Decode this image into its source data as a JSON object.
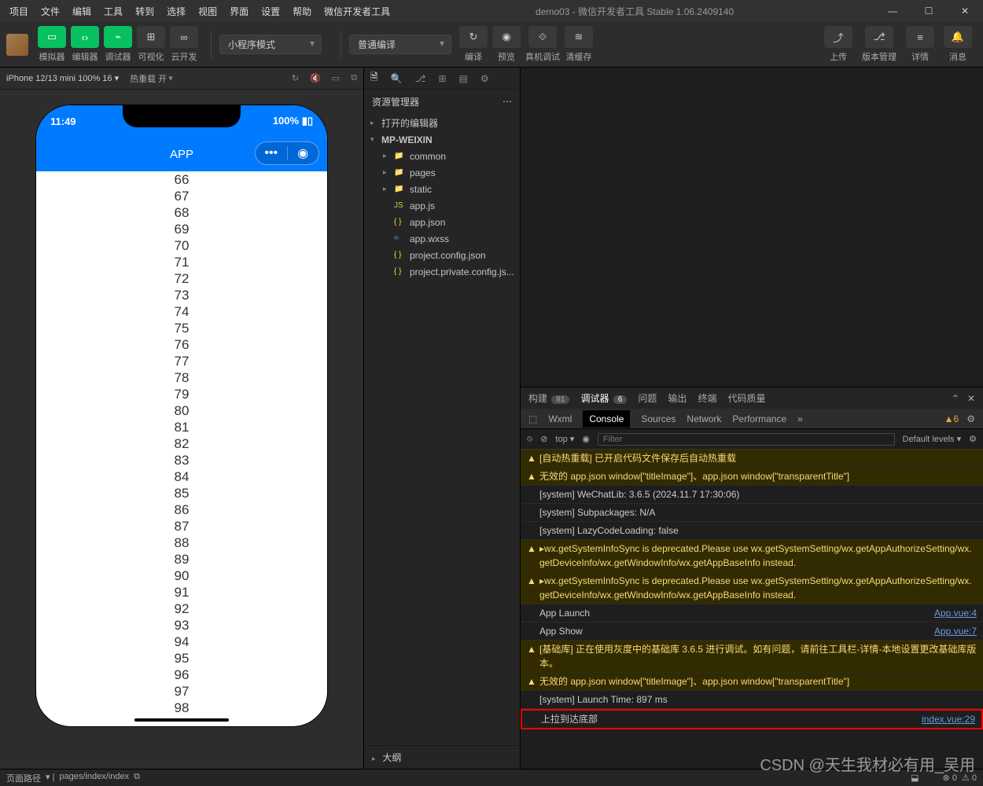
{
  "menu": [
    "项目",
    "文件",
    "编辑",
    "工具",
    "转到",
    "选择",
    "视图",
    "界面",
    "设置",
    "帮助",
    "微信开发者工具"
  ],
  "title_center": "demo03 - 微信开发者工具 Stable 1.06.2409140",
  "toolbar": {
    "simulator": "模拟器",
    "editor": "编辑器",
    "debugger": "调试器",
    "visual": "可视化",
    "cloud": "云开发",
    "mode_select": "小程序模式",
    "compile_select": "普通编译",
    "compile": "编译",
    "preview": "预览",
    "realdbg": "真机调试",
    "clear": "清缓存",
    "upload": "上传",
    "version": "版本管理",
    "detail": "详情",
    "msg": "消息"
  },
  "sim": {
    "device": "iPhone 12/13 mini 100% 16",
    "hotreload": "热重载 开",
    "time": "11:49",
    "battery": "100%",
    "app_title": "APP",
    "numbers": [
      66,
      67,
      68,
      69,
      70,
      71,
      72,
      73,
      74,
      75,
      76,
      77,
      78,
      79,
      80,
      81,
      82,
      83,
      84,
      85,
      86,
      87,
      88,
      89,
      90,
      91,
      92,
      93,
      94,
      95,
      96,
      97,
      98
    ]
  },
  "explorer": {
    "title": "资源管理器",
    "open_editors": "打开的编辑器",
    "root": "MP-WEIXIN",
    "items": [
      {
        "icon": "folder",
        "label": "common"
      },
      {
        "icon": "folder",
        "label": "pages"
      },
      {
        "icon": "folder",
        "label": "static"
      },
      {
        "icon": "js",
        "label": "app.js"
      },
      {
        "icon": "json",
        "label": "app.json"
      },
      {
        "icon": "css",
        "label": "app.wxss"
      },
      {
        "icon": "json",
        "label": "project.config.json"
      },
      {
        "icon": "json",
        "label": "project.private.config.js..."
      }
    ],
    "outline": "大纲"
  },
  "dbg_tabs": {
    "build": "构建",
    "build_n": "81",
    "debugger": "调试器",
    "debugger_n": "6",
    "problems": "问题",
    "output": "输出",
    "terminal": "终端",
    "codeq": "代码质量"
  },
  "devtools": {
    "wxml": "Wxml",
    "console": "Console",
    "sources": "Sources",
    "network": "Network",
    "performance": "Performance",
    "warn_count": "6",
    "top": "top",
    "filter_ph": "Filter",
    "levels": "Default levels"
  },
  "console_logs": [
    {
      "t": "warn",
      "m": "[自动热重载] 已开启代码文件保存后自动热重载"
    },
    {
      "t": "warn",
      "m": "无效的 app.json window[\"titleImage\"]、app.json window[\"transparentTitle\"]"
    },
    {
      "t": "info",
      "m": "[system] WeChatLib: 3.6.5 (2024.11.7 17:30:06)"
    },
    {
      "t": "info",
      "m": "[system] Subpackages: N/A"
    },
    {
      "t": "info",
      "m": "[system] LazyCodeLoading: false"
    },
    {
      "t": "warn",
      "m": "▸wx.getSystemInfoSync is deprecated.Please use wx.getSystemSetting/wx.getAppAuthorizeSetting/wx.getDeviceInfo/wx.getWindowInfo/wx.getAppBaseInfo instead."
    },
    {
      "t": "warn",
      "m": "▸wx.getSystemInfoSync is deprecated.Please use wx.getSystemSetting/wx.getAppAuthorizeSetting/wx.getDeviceInfo/wx.getWindowInfo/wx.getAppBaseInfo instead."
    },
    {
      "t": "info",
      "m": "App Launch",
      "src": "App.vue:4"
    },
    {
      "t": "info",
      "m": "App Show",
      "src": "App.vue:7"
    },
    {
      "t": "warn",
      "m": "[基础库] 正在使用灰度中的基础库 3.6.5 进行调试。如有问题，请前往工具栏-详情-本地设置更改基础库版本。"
    },
    {
      "t": "warn",
      "m": "无效的 app.json window[\"titleImage\"]、app.json window[\"transparentTitle\"]"
    },
    {
      "t": "info",
      "m": "[system] Launch Time: 897 ms"
    },
    {
      "t": "info",
      "m": "上拉到达底部",
      "src": "index.vue:29",
      "red": true
    }
  ],
  "footer": {
    "path_label": "页面路径",
    "path": "pages/index/index",
    "err": "0",
    "warn": "0"
  },
  "watermark": "CSDN @天生我材必有用_吴用"
}
